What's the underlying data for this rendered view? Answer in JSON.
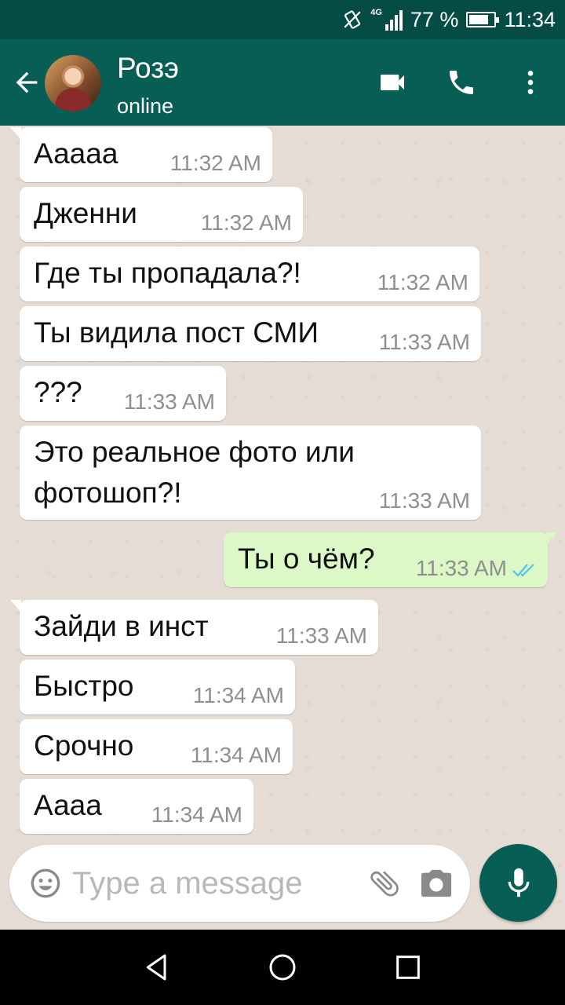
{
  "status_bar": {
    "network_label": "4G",
    "battery_text": "77 %",
    "battery_level": 0.77,
    "time": "11:34"
  },
  "header": {
    "contact_name": "Розэ",
    "contact_status": "online",
    "icons": [
      "back-arrow-icon",
      "avatar",
      "video-call-icon",
      "phone-call-icon",
      "more-options-icon"
    ]
  },
  "messages": [
    {
      "direction": "in",
      "text": "Ааааа",
      "time": "11:32 AM"
    },
    {
      "direction": "in",
      "text": "Дженни",
      "time": "11:32 AM"
    },
    {
      "direction": "in",
      "text": "Где ты пропадала?!",
      "time": "11:32 AM"
    },
    {
      "direction": "in",
      "text": "Ты видила пост СМИ",
      "time": "11:33 AM"
    },
    {
      "direction": "in",
      "text": "???",
      "time": "11:33 AM"
    },
    {
      "direction": "in",
      "text": "Это реальное фото или фотошоп?!",
      "time": "11:33 AM"
    },
    {
      "direction": "out",
      "text": "Ты о чём?",
      "time": "11:33 AM",
      "status": "read"
    },
    {
      "direction": "in",
      "text": "Зайди в инст",
      "time": "11:33 AM"
    },
    {
      "direction": "in",
      "text": "Быстро",
      "time": "11:34 AM"
    },
    {
      "direction": "in",
      "text": "Срочно",
      "time": "11:34 AM"
    },
    {
      "direction": "in",
      "text": "Аааа",
      "time": "11:34 AM"
    }
  ],
  "composer": {
    "placeholder": "Type a message",
    "value": ""
  },
  "colors": {
    "header": "#075e54",
    "status_bar": "#054d44",
    "outgoing_bubble": "#dcf8c6",
    "incoming_bubble": "#ffffff",
    "chat_background": "#e5ddd5",
    "read_ticks": "#4fc3f7"
  }
}
